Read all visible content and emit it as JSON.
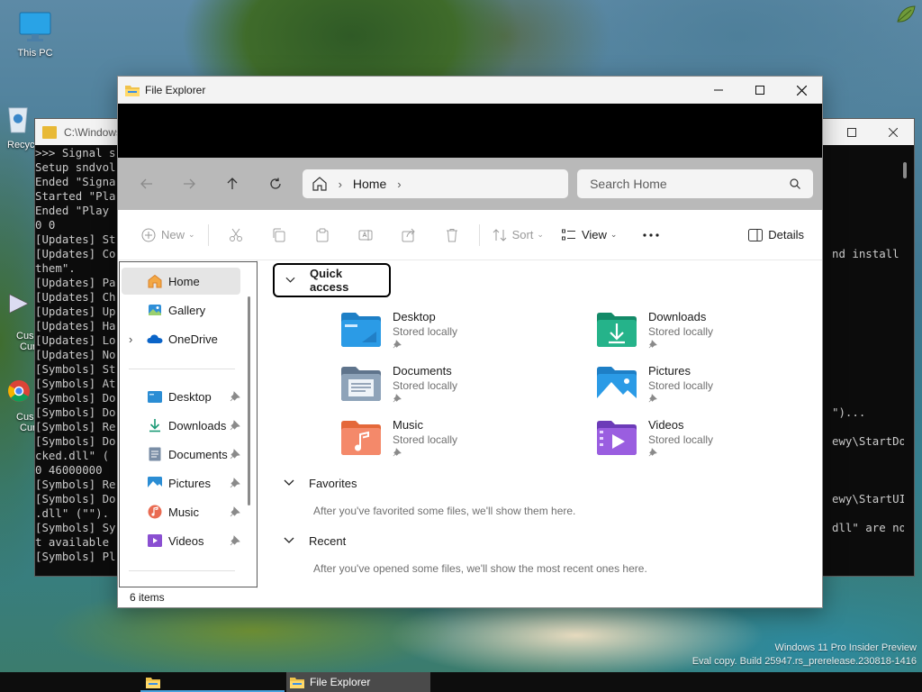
{
  "desktop": {
    "icons": [
      {
        "label": "This PC"
      },
      {
        "label": "Recyc"
      },
      {
        "label": "Cus",
        "label2": "Cur"
      },
      {
        "label": "Cus",
        "label2": "Cur"
      }
    ],
    "watermark_line1": "Windows 11 Pro Insider Preview",
    "watermark_line2": "Eval copy. Build 25947.rs_prerelease.230818-1416"
  },
  "console": {
    "title": "C:\\Windows",
    "lines": [
      ">>> Signal s",
      "Setup sndvol",
      "Ended \"Signa",
      "Started \"Pla",
      "Ended \"Play",
      "0 0",
      "[Updates] St",
      "[Updates] Co",
      "them\".",
      "[Updates] Pa",
      "[Updates] Ch",
      "[Updates] Up",
      "[Updates] Ha",
      "[Updates] Lo",
      "[Updates] No",
      "[Symbols] St",
      "[Symbols] At",
      "[Symbols] Do",
      "[Symbols] Do",
      "[Symbols] Re",
      "[Symbols] Do",
      "cked.dll\" (",
      "0 46000000",
      "[Symbols] Re",
      "[Symbols] Do",
      ".dll\" (\"\").",
      "[Symbols] Sy",
      "t available",
      "[Symbols] Pl"
    ],
    "right_lines": [
      "",
      "",
      "",
      "",
      "",
      "",
      "",
      "nd install",
      "",
      "",
      "",
      "",
      "",
      "",
      "",
      "",
      "",
      "",
      "\")...",
      "",
      "ewy\\StartDo",
      "",
      "",
      "",
      "ewy\\StartUI",
      "",
      "dll\" are no",
      "",
      ""
    ]
  },
  "explorer": {
    "title": "File Explorer",
    "breadcrumb": {
      "current": "Home"
    },
    "search": {
      "placeholder": "Search Home"
    },
    "commands": {
      "new": "New",
      "sort": "Sort",
      "view": "View",
      "details": "Details"
    },
    "nav": [
      {
        "label": "Home",
        "icon": "home-icon",
        "selected": true
      },
      {
        "label": "Gallery",
        "icon": "gallery-icon"
      },
      {
        "label": "OneDrive",
        "icon": "onedrive-icon",
        "expandable": true
      },
      {
        "label": "Desktop",
        "icon": "desktop-folder-icon",
        "pinned": true
      },
      {
        "label": "Downloads",
        "icon": "downloads-folder-icon",
        "pinned": true
      },
      {
        "label": "Documents",
        "icon": "documents-folder-icon",
        "pinned": true
      },
      {
        "label": "Pictures",
        "icon": "pictures-folder-icon",
        "pinned": true
      },
      {
        "label": "Music",
        "icon": "music-folder-icon",
        "pinned": true
      },
      {
        "label": "Videos",
        "icon": "videos-folder-icon",
        "pinned": true
      }
    ],
    "quick_access": {
      "label": "Quick access",
      "items": [
        {
          "name": "Desktop",
          "status": "Stored locally"
        },
        {
          "name": "Downloads",
          "status": "Stored locally"
        },
        {
          "name": "Documents",
          "status": "Stored locally"
        },
        {
          "name": "Pictures",
          "status": "Stored locally"
        },
        {
          "name": "Music",
          "status": "Stored locally"
        },
        {
          "name": "Videos",
          "status": "Stored locally"
        }
      ]
    },
    "favorites": {
      "label": "Favorites",
      "empty": "After you've favorited some files, we'll show them here."
    },
    "recent": {
      "label": "Recent",
      "empty": "After you've opened some files, we'll show the most recent ones here."
    },
    "status": "6 items"
  },
  "taskbar": {
    "items": [
      {
        "label": ""
      },
      {
        "label": "File Explorer"
      }
    ]
  },
  "colors": {
    "accent": "#0067c0",
    "folder_yellow": "#f0c24b"
  }
}
